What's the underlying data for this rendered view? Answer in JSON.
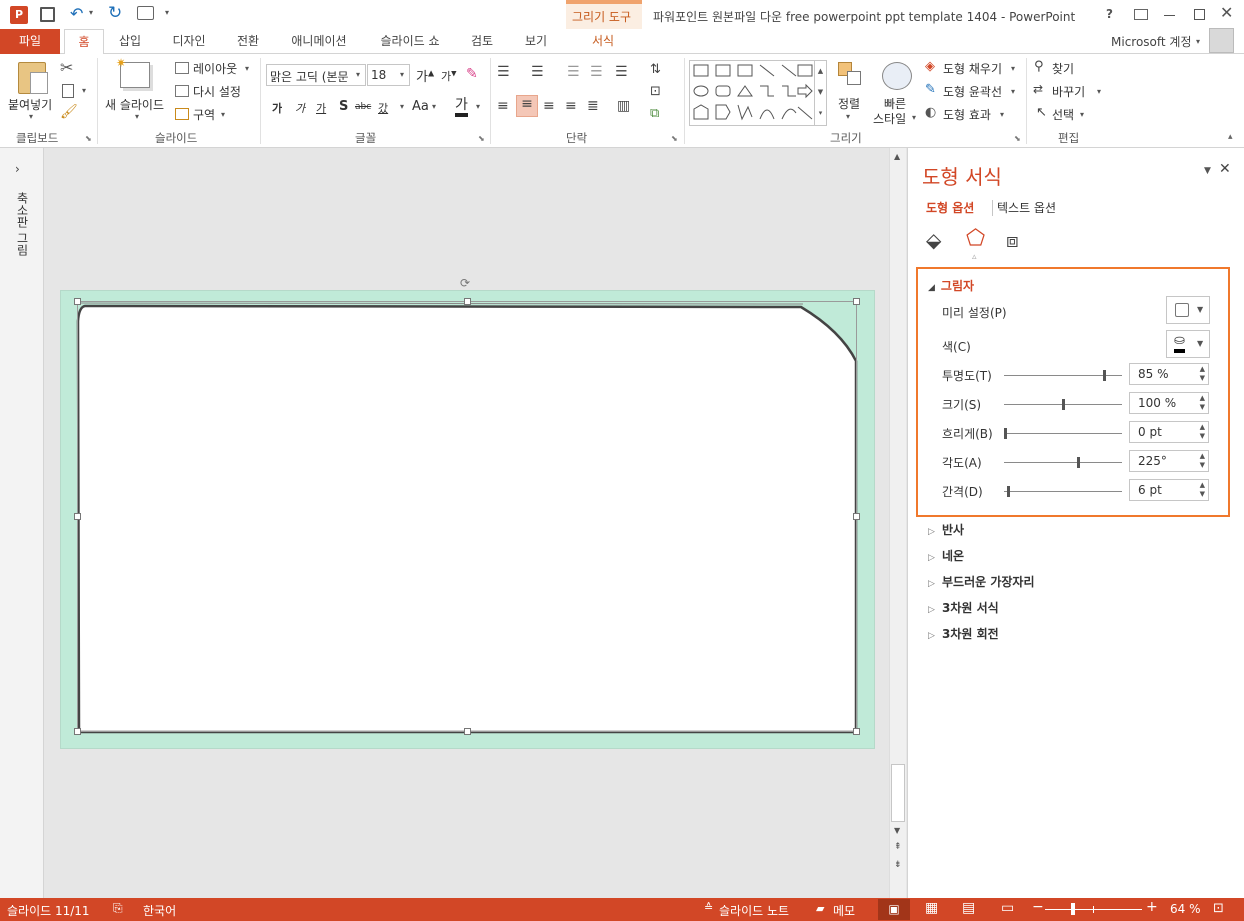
{
  "titlebar": {
    "contextual_label": "그리기 도구",
    "title": "파워포인트 원본파일 다운 free powerpoint ppt template 1404 - PowerPoint",
    "help": "?"
  },
  "tabs": [
    {
      "label": "파일"
    },
    {
      "label": "홈"
    },
    {
      "label": "삽입"
    },
    {
      "label": "디자인"
    },
    {
      "label": "전환"
    },
    {
      "label": "애니메이션"
    },
    {
      "label": "슬라이드 쇼"
    },
    {
      "label": "검토"
    },
    {
      "label": "보기"
    },
    {
      "label": "서식"
    }
  ],
  "account": "Microsoft 계정",
  "ribbon": {
    "clipboard": {
      "paste": "붙여넣기",
      "group": "클립보드"
    },
    "slides": {
      "new_slide": "새 슬라이드",
      "layout": "레이아웃",
      "reset": "다시 설정",
      "section": "구역",
      "group": "슬라이드"
    },
    "font": {
      "font_name": "맑은 고딕 (본문",
      "font_size": "18",
      "group": "글꼴",
      "bold": "가",
      "italic": "가",
      "underline": "가",
      "shadow": "S",
      "strike": "abc",
      "spacing": "갔",
      "case": "Aa",
      "color": "가"
    },
    "paragraph": {
      "group": "단락"
    },
    "drawing": {
      "arrange": "정렬",
      "quick_style_1": "빠른",
      "quick_style_2": "스타일",
      "fill": "도형 채우기",
      "outline": "도형 윤곽선",
      "effects": "도형 효과",
      "group": "그리기"
    },
    "editing": {
      "find": "찾기",
      "replace": "바꾸기",
      "select": "선택",
      "group": "편집"
    }
  },
  "thumbnail_pane": {
    "label": "축소판 그림"
  },
  "format_pane": {
    "title": "도형 서식",
    "tab_shape": "도형 옵션",
    "tab_text": "텍스트 옵션",
    "shadow": {
      "heading": "그림자",
      "preset": "미리 설정(P)",
      "color": "색(C)",
      "rows": [
        {
          "label": "투명도(T)",
          "value": "85 %",
          "level": 0.85
        },
        {
          "label": "크기(S)",
          "value": "100 %",
          "level": 0.5
        },
        {
          "label": "흐리게(B)",
          "value": "0 pt",
          "level": 0.0
        },
        {
          "label": "각도(A)",
          "value": "225°",
          "level": 0.625
        },
        {
          "label": "간격(D)",
          "value": "6 pt",
          "level": 0.03
        }
      ]
    },
    "sections": [
      "반사",
      "네온",
      "부드러운 가장자리",
      "3차원 서식",
      "3차원 회전"
    ]
  },
  "statusbar": {
    "slide": "슬라이드 11/11",
    "language": "한국어",
    "notes": "슬라이드 노트",
    "comments": "메모",
    "zoom": "64 %"
  },
  "colors": {
    "accent": "#d24726",
    "slide_bg": "#c0ead8",
    "highlight": "#f0782c"
  }
}
